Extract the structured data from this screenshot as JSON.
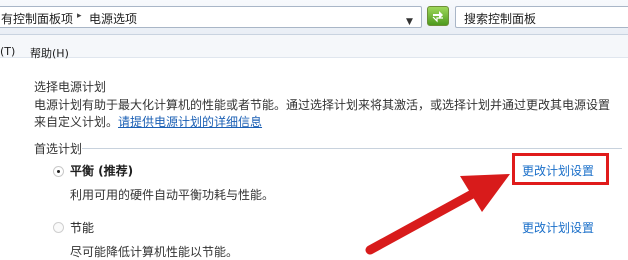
{
  "address_bar": {
    "crumb_1": "有控制面板项",
    "crumb_2": "电源选项",
    "search_placeholder": "搜索控制面板"
  },
  "menubar": {
    "item_1": "(T)",
    "item_2": "帮助(H)"
  },
  "main": {
    "heading": "选择电源计划",
    "description_line1": "电源计划有助于最大化计算机的性能或者节能。通过选择计划来将其激活，或选择计划并通过更改其电源设置",
    "description_line2_prefix": "来自定义计划。",
    "description_link": "请提供电源计划的详细信息",
    "section_title": "首选计划",
    "plans": [
      {
        "name": "平衡 (推荐)",
        "description": "利用可用的硬件自动平衡功耗与性能。",
        "change_label": "更改计划设置",
        "selected": true
      },
      {
        "name": "节能",
        "description": "尽可能降低计算机性能以节能。",
        "change_label": "更改计划设置",
        "selected": false
      }
    ]
  },
  "colors": {
    "link": "#1a6fc9",
    "annotation": "#e01b1b",
    "refresh_button": "#4e9a1e"
  }
}
